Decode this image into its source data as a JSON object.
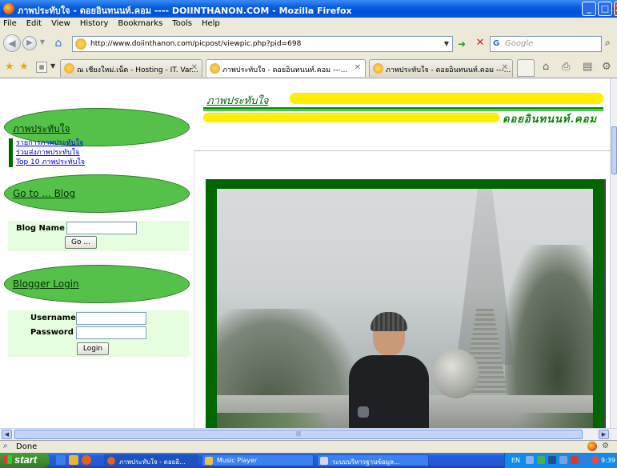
{
  "window": {
    "title": "ภาพประทับใจ - ดอยอินทนนท์.คอม ---- DOIINTHANON.COM - Mozilla Firefox",
    "min_label": "_",
    "max_label": "□",
    "close_label": "X"
  },
  "menu": [
    "File",
    "Edit",
    "View",
    "History",
    "Bookmarks",
    "Tools",
    "Help"
  ],
  "nav": {
    "url": "http://www.doiinthanon.com/picpost/viewpic.php?pid=698",
    "search_placeholder": "Google"
  },
  "tabs": [
    {
      "label": "ณ เชียงใหม่.เน็ต - Hosting - IT. Var..."
    },
    {
      "label": "ภาพประทับใจ - ดอยอินทนนท์.คอม ---..."
    },
    {
      "label": "ภาพประทับใจ - ดอยอินทนนท์.คอม ---..."
    }
  ],
  "page": {
    "header_title": "ภาพประทับใจ",
    "site_name": "ดอยอินทนนท์.คอม",
    "sidebar": {
      "section1_title": "ภาพประทับใจ",
      "links": [
        "รายการภาพประทับใจ",
        "ร่วมส่งภาพประทับใจ",
        "Top 10 ภาพประทับใจ"
      ],
      "section2_title": "Go to ... Blog",
      "blog_name_label": "Blog Name :",
      "blog_name_value": "",
      "go_button": "Go ...",
      "section3_title": "Blogger Login",
      "username_label": "Username :",
      "password_label": "Password :",
      "username_value": "",
      "password_value": "",
      "login_button": "Login"
    }
  },
  "status": {
    "text": "Done"
  },
  "taskbar": {
    "start_label": "start",
    "items": [
      {
        "label": "ภาพประทับใจ - ดอยอิ..."
      },
      {
        "label": "Music Player"
      },
      {
        "label": "ระบบบริหารฐานข้อมูล..."
      }
    ],
    "language": "EN",
    "clock": "9:39"
  },
  "colors": {
    "sidebar_oval": "#55c04a",
    "header_yellow": "#ffee00",
    "frame_green": "#006600"
  }
}
